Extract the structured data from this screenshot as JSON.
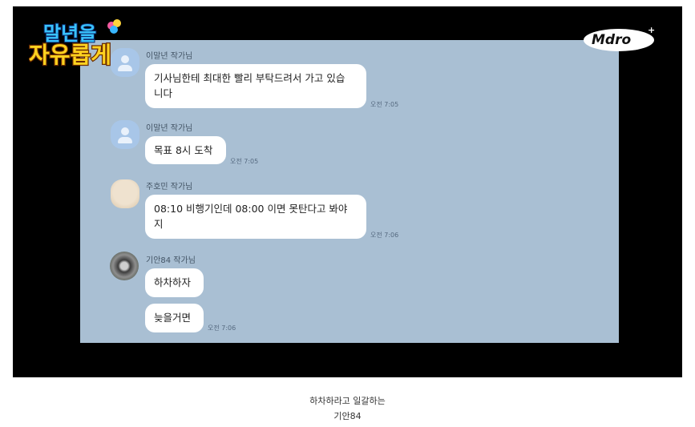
{
  "show": {
    "title_line1": "말년을",
    "title_line2": "자유롭게",
    "channel_logo": "Mdro"
  },
  "messages": [
    {
      "sender": "이말년 작가님",
      "avatar": "default-person-icon",
      "lines": [
        "기사님한테 최대한 빨리 부탁드려서 가고 있습",
        "니다"
      ],
      "time": "오전 7:05"
    },
    {
      "sender": "이말년 작가님",
      "avatar": "default-person-icon",
      "lines": [
        "목표 8시 도착"
      ],
      "time": "오전 7:05"
    },
    {
      "sender": "주호민 작가님",
      "avatar": "beige-character-avatar",
      "lines": [
        "08:10 비행기인데 08:00 이면 못탄다고 봐야",
        "지"
      ],
      "time": "오전 7:06"
    },
    {
      "sender": "기안84 작가님",
      "avatar": "raccoon-photo-avatar",
      "lines": [
        "하차하자"
      ],
      "time": ""
    },
    {
      "sender": "",
      "avatar": "",
      "lines": [
        "늦을거면"
      ],
      "time": "오전 7:06"
    }
  ],
  "caption": {
    "line1": "하차하라고 일갈하는",
    "line2": "기안84"
  },
  "colors": {
    "chat_background": "#a9bfd3",
    "bubble": "#ffffff",
    "frame": "#000000"
  }
}
